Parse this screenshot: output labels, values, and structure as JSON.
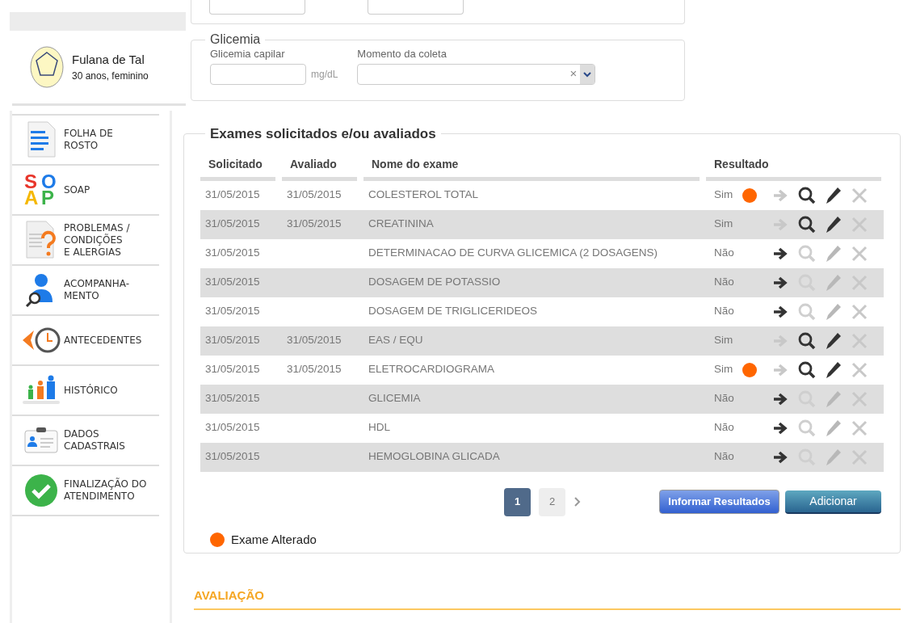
{
  "patient": {
    "name": "Fulana de Tal",
    "details": "30 anos, feminino"
  },
  "sidebar": {
    "items": [
      {
        "label": "FOLHA DE\nROSTO",
        "selected": false
      },
      {
        "label": "SOAP",
        "selected": false,
        "logo_letters": [
          "S",
          "O",
          "A",
          "P"
        ]
      },
      {
        "label": "PROBLEMAS /\nCONDIÇÕES\nE ALERGIAS",
        "selected": false
      },
      {
        "label": "ACOMPANHA-\nMENTO",
        "selected": false
      },
      {
        "label": "ANTECEDENTES",
        "selected": false
      },
      {
        "label": "HISTÓRICO",
        "selected": false
      },
      {
        "label": "DADOS\nCADASTRAIS",
        "selected": false
      },
      {
        "label": "FINALIZAÇÃO DO\nATENDIMENTO",
        "selected": false
      }
    ]
  },
  "glicemia": {
    "legend": "Glicemia",
    "capilar_label": "Glicemia capilar",
    "unit": "mg/dL",
    "momento_label": "Momento da coleta",
    "clear": "×"
  },
  "exames": {
    "legend": "Exames solicitados e/ou avaliados",
    "columns": [
      "Solicitado",
      "Avaliado",
      "Nome do exame",
      "Resultado"
    ],
    "rows": [
      {
        "solicitado": "31/05/2015",
        "avaliado": "31/05/2015",
        "nome": "COLESTEROL TOTAL",
        "resultado": "Sim",
        "informed": true,
        "altered": true
      },
      {
        "solicitado": "31/05/2015",
        "avaliado": "31/05/2015",
        "nome": "CREATININA",
        "resultado": "Sim",
        "informed": true,
        "altered": false
      },
      {
        "solicitado": "31/05/2015",
        "nome": "DETERMINACAO DE CURVA GLICEMICA (2 DOSAGENS)",
        "resultado": "Não",
        "informed": false,
        "altered": false
      },
      {
        "solicitado": "31/05/2015",
        "nome": "DOSAGEM DE POTASSIO",
        "resultado": "Não",
        "informed": false,
        "altered": false
      },
      {
        "solicitado": "31/05/2015",
        "nome": "DOSAGEM DE TRIGLICERIDEOS",
        "resultado": "Não",
        "informed": false,
        "altered": false
      },
      {
        "solicitado": "31/05/2015",
        "avaliado": "31/05/2015",
        "nome": "EAS / EQU",
        "resultado": "Sim",
        "informed": true,
        "altered": false
      },
      {
        "solicitado": "31/05/2015",
        "avaliado": "31/05/2015",
        "nome": "ELETROCARDIOGRAMA",
        "resultado": "Sim",
        "informed": true,
        "altered": true
      },
      {
        "solicitado": "31/05/2015",
        "nome": "GLICEMIA",
        "resultado": "Não",
        "informed": false,
        "altered": false
      },
      {
        "solicitado": "31/05/2015",
        "nome": "HDL",
        "resultado": "Não",
        "informed": false,
        "altered": false
      },
      {
        "solicitado": "31/05/2015",
        "nome": "HEMOGLOBINA GLICADA",
        "resultado": "Não",
        "informed": false,
        "altered": false
      }
    ],
    "pages": [
      {
        "label": "1",
        "selected": true
      },
      {
        "label": "2",
        "selected": false
      }
    ],
    "buttons": [
      "Informar Resultados",
      "Adicionar"
    ],
    "legend_altered": "Exame Alterado"
  },
  "avaliacao": {
    "title": "AVALIAÇÃO"
  }
}
